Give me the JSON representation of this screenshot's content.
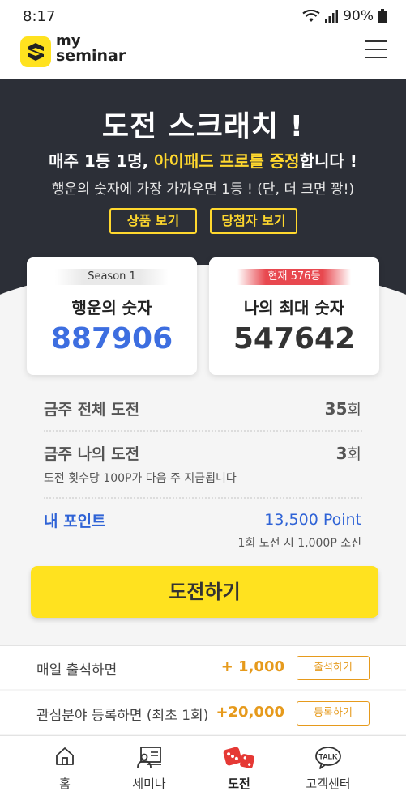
{
  "status": {
    "time": "8:17",
    "battery": "90%"
  },
  "header": {
    "logo_line1": "my",
    "logo_line2": "seminar"
  },
  "hero": {
    "title": "도전 스크래치 !",
    "subtitle_prefix": "매주 1등 1명, ",
    "subtitle_highlight": "아이패드 프로를 증정",
    "subtitle_suffix": "합니다 !",
    "description": "행운의 숫자에 가장 가까우면 1등 ! (단, 더 크면 꽝!)",
    "button_products": "상품 보기",
    "button_winners": "당첨자 보기"
  },
  "cards": {
    "lucky": {
      "badge": "Season 1",
      "label": "행운의 숫자",
      "value": "887906"
    },
    "mine": {
      "badge": "현재 576등",
      "label": "나의 최대 숫자",
      "value": "547642"
    }
  },
  "stats": {
    "total_label": "금주 전체 도전",
    "total_count": "35",
    "my_label": "금주 나의 도전",
    "my_count": "3",
    "unit": "회",
    "note": "도전 횟수당 100P가 다음 주 지급됩니다"
  },
  "points": {
    "label": "내 포인트",
    "value": "13,500 Point",
    "note": "1회 도전 시 1,000P 소진"
  },
  "challenge_button": "도전하기",
  "rewards": [
    {
      "label": "매일 출석하면",
      "amount": "+ 1,000",
      "button": "출석하기"
    },
    {
      "label": "관심분야 등록하면 (최초 1회)",
      "amount": "+20,000",
      "button": "등록하기"
    }
  ],
  "nav": [
    {
      "label": "홈",
      "icon": "home-icon"
    },
    {
      "label": "세미나",
      "icon": "seminar-icon"
    },
    {
      "label": "도전",
      "icon": "dice-icon"
    },
    {
      "label": "고객센터",
      "icon": "talk-icon"
    }
  ],
  "colors": {
    "brand_yellow": "#ffe21f",
    "hero_dark": "#2c2f37",
    "highlight_yellow": "#ffd82e",
    "lucky_blue": "#3d6ee0",
    "rank_red": "#e8484f",
    "reward_orange": "#e69a1c",
    "dice_red": "#e53935"
  }
}
